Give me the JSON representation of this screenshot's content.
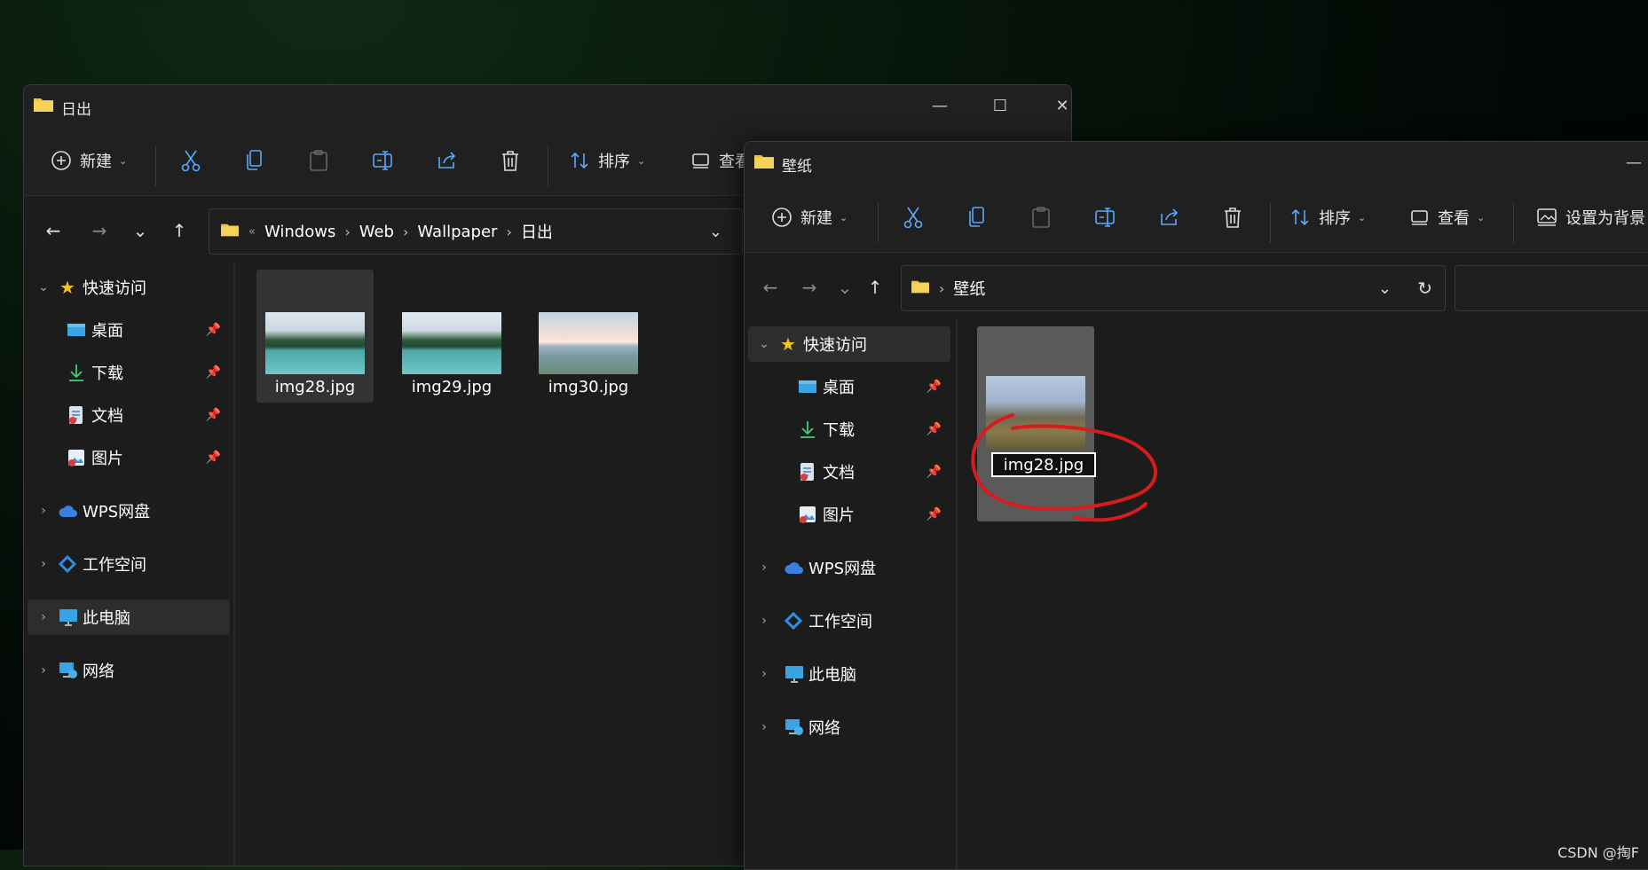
{
  "window1": {
    "title": "日出",
    "controls": {
      "minimize": "—",
      "maximize": "☐",
      "close": "✕"
    },
    "toolbar": {
      "new_label": "新建",
      "sort_label": "排序",
      "view_label": "查看"
    },
    "breadcrumb": [
      "Windows",
      "Web",
      "Wallpaper",
      "日出"
    ],
    "breadcrumb_overflow": "«",
    "sidebar": {
      "quick_access": "快速访问",
      "items": [
        {
          "label": "桌面"
        },
        {
          "label": "下载"
        },
        {
          "label": "文档"
        },
        {
          "label": "图片"
        }
      ],
      "wps": "WPS网盘",
      "workspace": "工作空间",
      "this_pc": "此电脑",
      "network": "网络"
    },
    "files": [
      {
        "name": "img28.jpg"
      },
      {
        "name": "img29.jpg"
      },
      {
        "name": "img30.jpg"
      }
    ]
  },
  "window2": {
    "title": "壁纸",
    "controls": {
      "minimize": "—"
    },
    "toolbar": {
      "new_label": "新建",
      "sort_label": "排序",
      "view_label": "查看",
      "set_background_label": "设置为背景"
    },
    "breadcrumb": [
      "壁纸"
    ],
    "sidebar": {
      "quick_access": "快速访问",
      "items": [
        {
          "label": "桌面"
        },
        {
          "label": "下载"
        },
        {
          "label": "文档"
        },
        {
          "label": "图片"
        }
      ],
      "wps": "WPS网盘",
      "workspace": "工作空间",
      "this_pc": "此电脑",
      "network": "网络"
    },
    "files": [
      {
        "name": "img28.jpg"
      }
    ]
  },
  "watermark": "CSDN @掏F",
  "colors": {
    "accent_annotation": "#d61c1c",
    "folder": "#f0c040",
    "star": "#f5c518"
  }
}
